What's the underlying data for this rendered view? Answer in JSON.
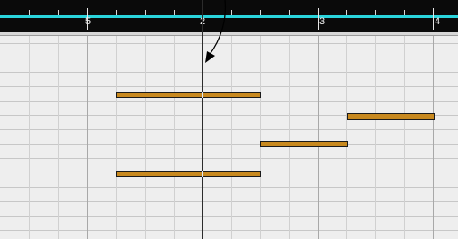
{
  "ruler": {
    "bar_labels": [
      "5",
      "2",
      "3",
      "4"
    ]
  },
  "colors": {
    "ruler_background": "#0a0a0a",
    "ruler_accent": "#2ad4dc",
    "grid_background": "#eeeeee",
    "note_fill": "#c8891f",
    "playhead": "#2c2c2c"
  },
  "icons": {
    "pointer": "arrow-pointer-icon"
  }
}
